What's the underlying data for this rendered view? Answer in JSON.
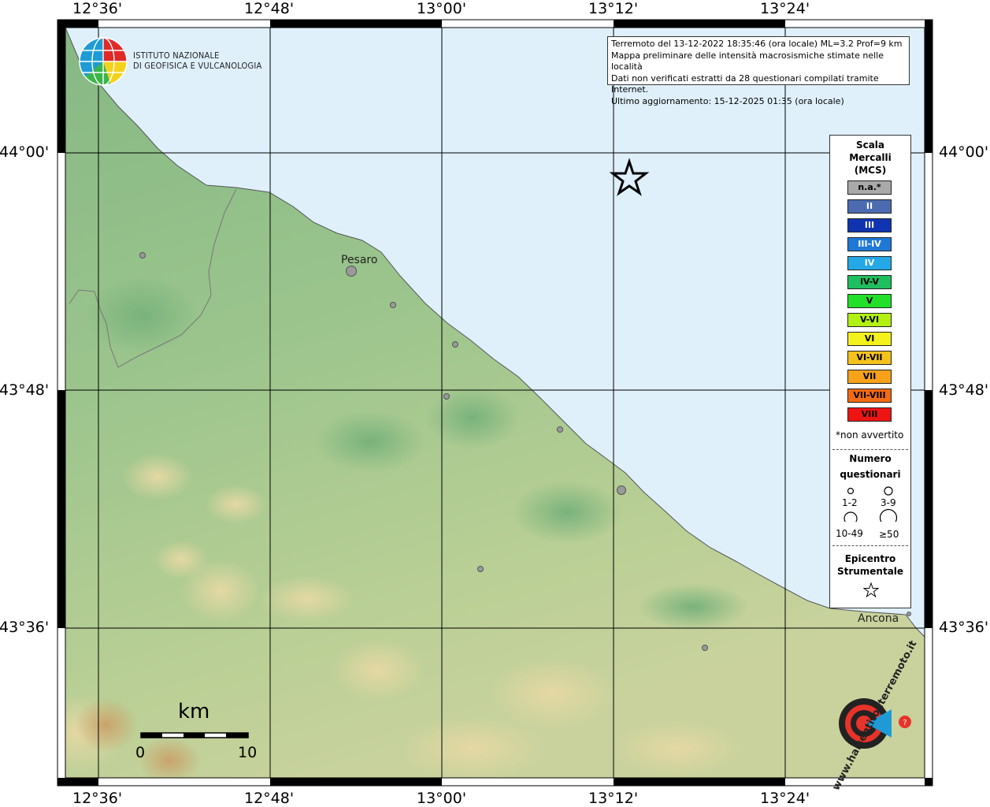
{
  "map": {
    "institute_line1": "ISTITUTO NAZIONALE",
    "institute_line2": "DI GEOFISICA E VULCANOLOGIA",
    "info_lines": [
      "Terremoto del 13-12-2022 18:35:46 (ora locale) ML=3.2 Prof=9 km",
      "Mappa preliminare delle intensità macrosismiche stimate nelle località",
      "Dati non verificati estratti da 28 questionari compilati tramite Internet.",
      "Ultimo aggiornamento: 15-12-2025 01:35 (ora locale)"
    ],
    "lon_labels": [
      "12°36'",
      "12°48'",
      "13°00'",
      "13°12'",
      "13°24'"
    ],
    "lat_labels": [
      "44°00'",
      "43°48'",
      "43°36'"
    ],
    "places": [
      {
        "name": "Pesaro"
      },
      {
        "name": "Ancona"
      }
    ],
    "scale_bar": {
      "unit": "km",
      "min_label": "0",
      "max_label": "10"
    },
    "watermark": "www.haisentitoilterremoto.it"
  },
  "legend": {
    "title": [
      "Scala",
      "Mercalli",
      "(MCS)"
    ],
    "items": [
      {
        "label": "n.a.*",
        "color": "#a9a9a9"
      },
      {
        "label": "II",
        "color": "#4d6bb0"
      },
      {
        "label": "III",
        "color": "#1034b0"
      },
      {
        "label": "III-IV",
        "color": "#1e78d6"
      },
      {
        "label": "IV",
        "color": "#24a8e6"
      },
      {
        "label": "IV-V",
        "color": "#1fbf5f"
      },
      {
        "label": "V",
        "color": "#22e02a"
      },
      {
        "label": "V-VI",
        "color": "#b2f012"
      },
      {
        "label": "VI",
        "color": "#f4f21c"
      },
      {
        "label": "VI-VII",
        "color": "#f4c21c"
      },
      {
        "label": "VII",
        "color": "#f7a21a"
      },
      {
        "label": "VII-VIII",
        "color": "#f26a14"
      },
      {
        "label": "VIII",
        "color": "#ef1414"
      }
    ],
    "footnote": "*non avvertito",
    "count_title": [
      "Numero",
      "questionari"
    ],
    "count_classes": [
      "1-2",
      "3-9",
      "10-49",
      "≥50"
    ],
    "epicenter_title": [
      "Epicentro",
      "Strumentale"
    ]
  },
  "colors": {
    "sea": "#dff0fb",
    "land_low": "#8dbd8a",
    "land_high": "#e8dcaa",
    "grid": "#000000",
    "point": "#999999"
  }
}
